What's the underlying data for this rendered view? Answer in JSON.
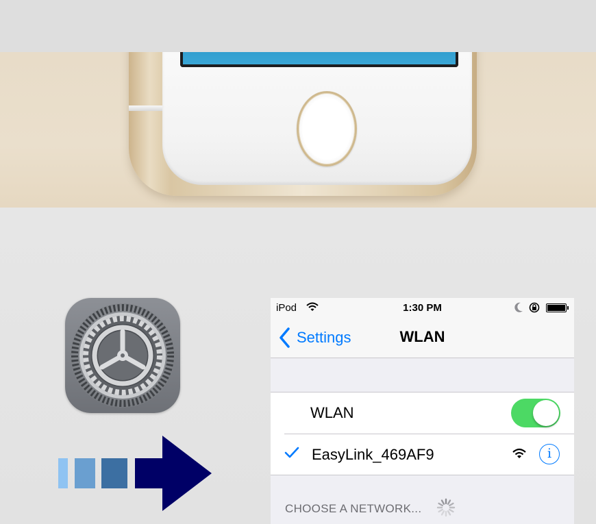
{
  "colors": {
    "ios_blue": "#007aff",
    "toggle_on": "#4cd964",
    "arrow_head": "#000066",
    "arrow_steps": [
      "#8fc3f2",
      "#6a9fd0",
      "#3c6fa2"
    ],
    "photo_bg": "#e8dcc8",
    "settings_bg": "#efeff4"
  },
  "status_bar": {
    "carrier": "iPod",
    "time": "1:30 PM",
    "icons": [
      "wifi-icon",
      "moon-icon",
      "rotation-lock-icon",
      "battery-icon"
    ]
  },
  "nav": {
    "back_label": "Settings",
    "title": "WLAN"
  },
  "wlan_row": {
    "label": "WLAN",
    "toggle_on": true
  },
  "connected_network": {
    "name": "EasyLink_469AF9",
    "selected": true,
    "icons": [
      "checkmark-icon",
      "wifi-signal-icon",
      "info-icon"
    ],
    "info_glyph": "i"
  },
  "section": {
    "choose_network": "CHOOSE A NETWORK..."
  },
  "illustration": {
    "app_icon": "settings-gear-icon",
    "device": "iphone-home-button",
    "arrow": "right-arrow-icon"
  }
}
